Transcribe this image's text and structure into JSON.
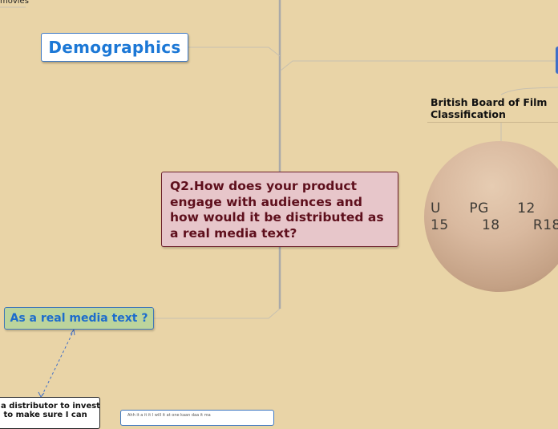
{
  "nodes": {
    "top_fragment": "movies",
    "demographics": "Demographics",
    "central_question": "Q2.How does your product engage with audiences and how would it be distributed as a real media text?",
    "real_media_text": "As a real media text ?",
    "bbfc_title": "British Board of Film Classification",
    "ratings_line1": "U      PG      12",
    "ratings_line2": "15       18       R18",
    "distributor_fragment": "a distributor to invest\n to make sure I can",
    "bottom_card_fragment": "Ahh it a it it I will it at one kaan daa it ma"
  },
  "colors": {
    "background": "#e9d4a7",
    "central_fill": "#e7c6ca",
    "central_text": "#5e0f1c",
    "blue_text": "#1c78d6",
    "green_fill": "#bcd49c"
  }
}
